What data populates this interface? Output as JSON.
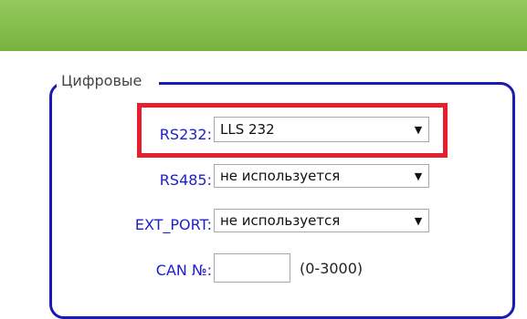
{
  "section": {
    "legend": "Цифровые"
  },
  "rows": {
    "rs232": {
      "label": "RS232:",
      "value": "LLS 232"
    },
    "rs485": {
      "label": "RS485:",
      "value": "не используется"
    },
    "ext_port": {
      "label": "EXT_PORT:",
      "value": "не используется"
    },
    "can": {
      "label": "CAN №:",
      "value": "",
      "hint": "(0-3000)"
    }
  },
  "icons": {
    "dropdown_arrow": "▼"
  },
  "colors": {
    "header_green": "#86bf4d",
    "label_blue": "#2020c8",
    "fieldset_border": "#1a1ab4",
    "highlight_red": "#e5202d"
  }
}
